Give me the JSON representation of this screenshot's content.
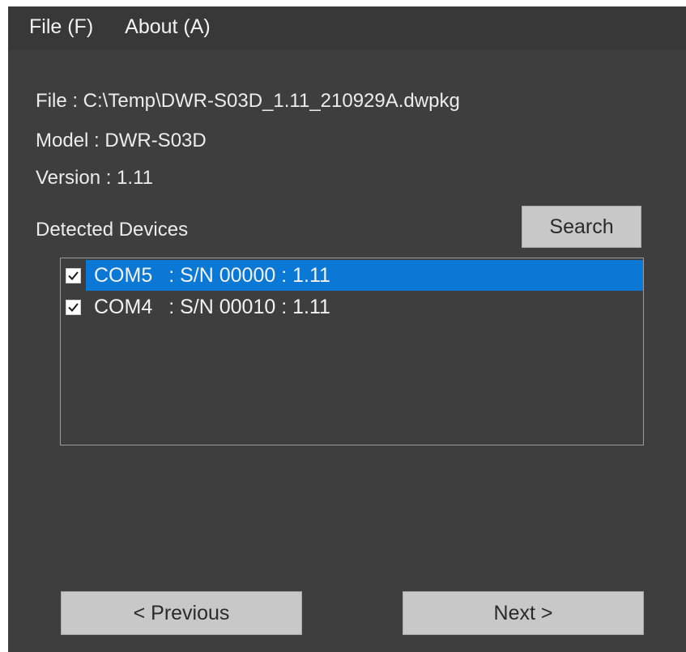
{
  "menu": {
    "file_label": "File (F)",
    "about_label": "About (A)"
  },
  "info": {
    "file_line": "File : C:\\Temp\\DWR-S03D_1.11_210929A.dwpkg",
    "model_line": "Model : DWR-S03D",
    "version_line": "Version :  1.11"
  },
  "devices": {
    "section_label": "Detected Devices",
    "search_label": "Search",
    "items": [
      {
        "port": "COM5",
        "detail": ": S/N 00000 : 1.11",
        "checked": true,
        "selected": true
      },
      {
        "port": "COM4",
        "detail": ": S/N 00010 : 1.11",
        "checked": true,
        "selected": false
      }
    ]
  },
  "nav": {
    "previous_label": "< Previous",
    "next_label": "Next  >"
  },
  "colors": {
    "selection": "#0a78d4",
    "background": "#3e3e3e"
  },
  "icons": {
    "checkbox": "checkmark-icon"
  }
}
